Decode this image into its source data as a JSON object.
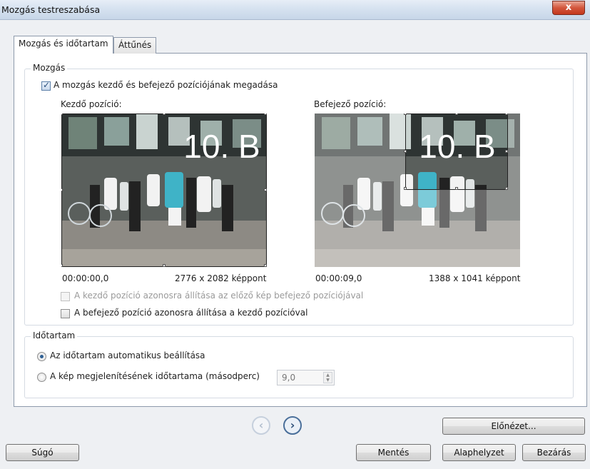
{
  "window": {
    "title": "Mozgás testreszabása",
    "close_glyph": "x"
  },
  "tabs": [
    {
      "label": "Mozgás és időtartam",
      "active": true
    },
    {
      "label": "Áttűnés",
      "active": false
    }
  ],
  "motion": {
    "group_label": "Mozgás",
    "enable_checkbox": {
      "label": "A mozgás kezdő és befejező pozíciójának megadása",
      "checked": true
    },
    "start": {
      "heading": "Kezdő pozíció:",
      "time": "00:00:00,0",
      "size": "2776 x 2082 képpont",
      "overlay_text": "10. B"
    },
    "end": {
      "heading": "Befejező pozíció:",
      "time": "00:00:09,0",
      "size": "1388 x 1041 képpont",
      "overlay_text": "10. B"
    },
    "same_as_prev_checkbox": {
      "label": "A kezdő pozíció azonosra állítása az előző kép befejező pozíciójával",
      "checked": false,
      "disabled": true
    },
    "same_as_start_checkbox": {
      "label": "A befejező pozíció azonosra állítása a kezdő pozícióval",
      "checked": false,
      "disabled": false
    }
  },
  "duration": {
    "group_label": "Időtartam",
    "auto_radio": {
      "label": "Az időtartam automatikus beállítása",
      "checked": true
    },
    "manual_radio": {
      "label": "A kép megjelenítésének időtartama (másodperc)",
      "checked": false
    },
    "seconds_value": "9,0"
  },
  "nav": {
    "prev_glyph": "‹",
    "next_glyph": "›"
  },
  "buttons": {
    "preview": "Előnézet...",
    "help": "Súgó",
    "save": "Mentés",
    "reset": "Alaphelyzet",
    "close": "Bezárás"
  },
  "colors": {
    "title_bar": "#d6e2f0",
    "close_button": "#d3563c",
    "accent": "#2e5f93"
  }
}
